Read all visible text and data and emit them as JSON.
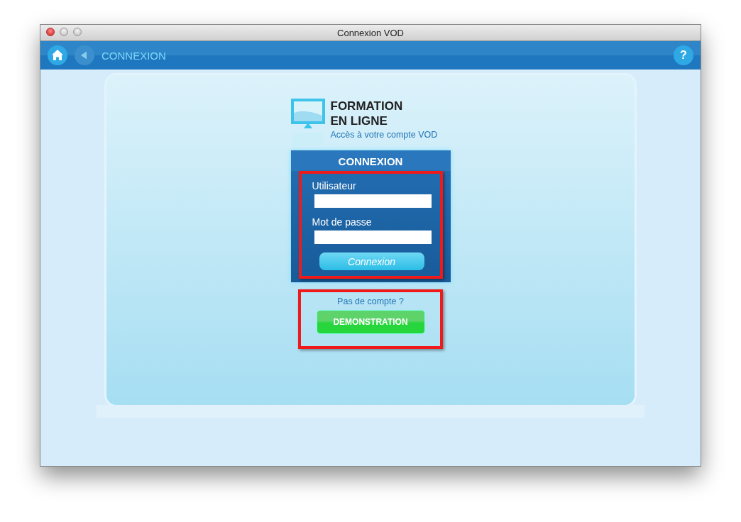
{
  "window": {
    "title": "Connexion VOD"
  },
  "toolbar": {
    "title": "CONNEXION",
    "help": "?"
  },
  "logo": {
    "title_lines": [
      "FORMATION",
      "EN LIGNE"
    ],
    "subtitle": "Accès à votre compte VOD"
  },
  "login": {
    "header": "CONNEXION",
    "highlighted": true,
    "fields": [
      {
        "label": "Utilisateur"
      },
      {
        "label": "Mot de passe"
      }
    ],
    "button": "Connexion"
  },
  "signup": {
    "highlighted": true,
    "prompt": "Pas de compte ?",
    "button": "DEMONSTRATION"
  }
}
